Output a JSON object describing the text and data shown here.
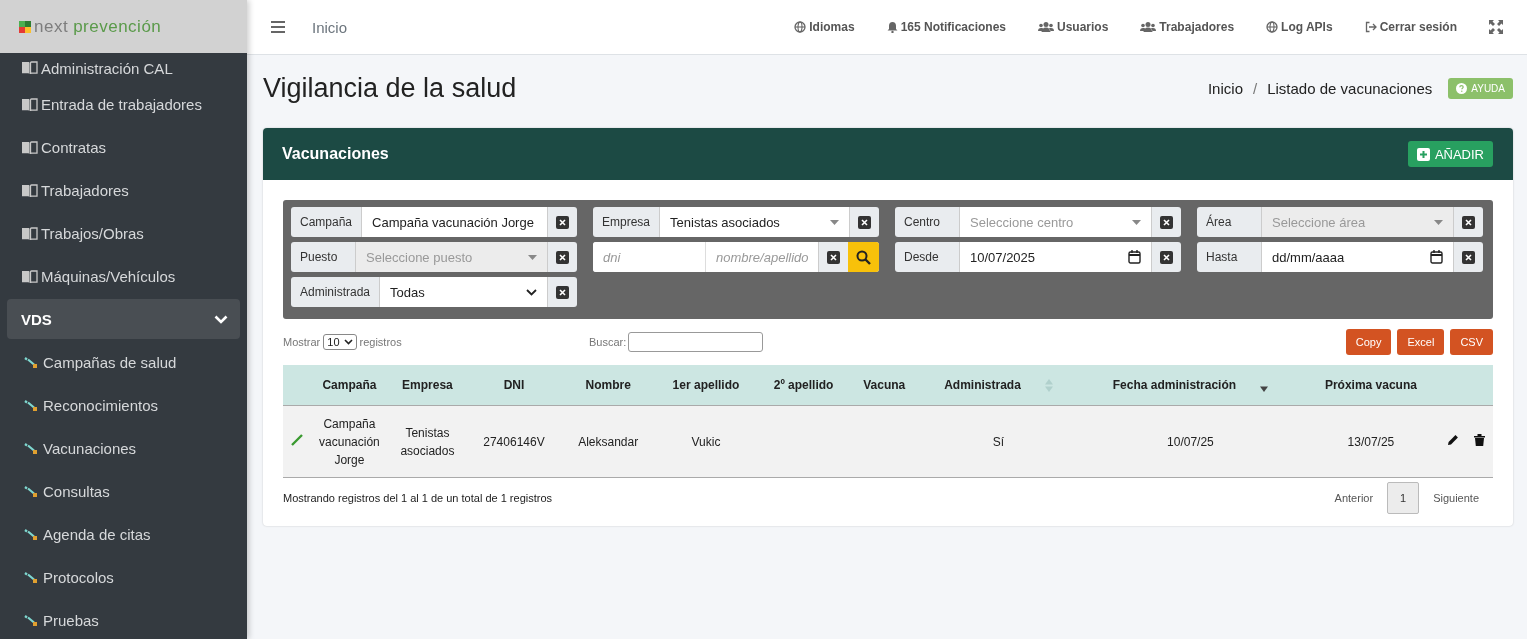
{
  "logo": {
    "part_1": "next",
    "part_2": "prevención"
  },
  "sidebar": {
    "items": [
      {
        "label": "Administración CAL",
        "kind": "book"
      },
      {
        "label": "Entrada de trabajadores",
        "kind": "book"
      },
      {
        "label": "Contratas",
        "kind": "book"
      },
      {
        "label": "Trabajadores",
        "kind": "book"
      },
      {
        "label": "Trabajos/Obras",
        "kind": "book"
      },
      {
        "label": "Máquinas/Vehículos",
        "kind": "book"
      },
      {
        "label": "VDS",
        "kind": "group",
        "expanded": true,
        "children": [
          {
            "label": "Campañas de salud"
          },
          {
            "label": "Reconocimientos"
          },
          {
            "label": "Vacunaciones"
          },
          {
            "label": "Consultas"
          },
          {
            "label": "Agenda de citas"
          },
          {
            "label": "Protocolos"
          },
          {
            "label": "Pruebas"
          }
        ]
      }
    ]
  },
  "topbar": {
    "breadcrumb": "Inicio",
    "links": [
      {
        "label": "Idiomas",
        "kind": "globe"
      },
      {
        "label": "165 Notificaciones",
        "kind": "bell"
      },
      {
        "label": "Usuarios",
        "kind": "users"
      },
      {
        "label": "Trabajadores",
        "kind": "users"
      },
      {
        "label": "Log APIs",
        "kind": "globe"
      },
      {
        "label": "Cerrar sesión",
        "kind": "logout"
      }
    ]
  },
  "page": {
    "title": "Vigilancia de la salud",
    "breadcrumb": [
      "Inicio",
      "Listado de vacunaciones"
    ],
    "breadcrumb_separator": "/",
    "help_button": "AYUDA"
  },
  "card": {
    "title": "Vacunaciones",
    "add_button": "AÑADIR",
    "filters": [
      {
        "kind": "select",
        "label": "Campaña",
        "value": "Campaña vacunación Jorge",
        "disabled": false
      },
      {
        "kind": "select",
        "label": "Empresa",
        "value": "Tenistas asociados",
        "disabled": false
      },
      {
        "kind": "select",
        "label": "Centro",
        "placeholder": "Seleccione centro",
        "disabled": false
      },
      {
        "kind": "select",
        "label": "Área",
        "placeholder": "Seleccione área",
        "disabled": true
      },
      {
        "kind": "select",
        "label": "Puesto",
        "placeholder": "Seleccione puesto",
        "disabled": true
      },
      {
        "kind": "search-pair",
        "placeholder": "dni",
        "placeholder_2": "nombre/apellido"
      },
      {
        "kind": "date",
        "label": "Desde",
        "value": "10/07/2025"
      },
      {
        "kind": "date",
        "label": "Hasta",
        "placeholder": "dd/mm/aaaa"
      },
      {
        "kind": "native-select",
        "label": "Administrada",
        "value": "Todas"
      }
    ],
    "length_label": "Mostrar",
    "length_value": "10",
    "length_suffix": "registros",
    "search_label": "Buscar:",
    "export_buttons": [
      "Copy",
      "Excel",
      "CSV"
    ],
    "columns": [
      {
        "label": "Campaña",
        "sortable": false
      },
      {
        "label": "Empresa",
        "sortable": false
      },
      {
        "label": "DNI",
        "sortable": false
      },
      {
        "label": "Nombre",
        "sortable": false
      },
      {
        "label": "1er apellido",
        "sortable": false
      },
      {
        "label": "2º apellido",
        "sortable": false
      },
      {
        "label": "Vacuna",
        "sortable": false
      },
      {
        "label": "Administrada",
        "sortable": true,
        "sorted_descending": false
      },
      {
        "label": "Fecha administración",
        "sortable": true,
        "sorted_descending": true
      },
      {
        "label": "Próxima vacuna",
        "sortable": false
      }
    ],
    "rows": [
      {
        "cells": [
          "Campaña vacunación Jorge",
          "Tenistas asociados",
          "27406146V",
          "Aleksandar",
          "Vukic",
          "",
          "",
          "Sí",
          "10/07/25",
          "13/07/25"
        ]
      }
    ],
    "info": "Mostrando registros del 1 al 1 de un total de 1 registros",
    "pagination": {
      "previous": "Anterior",
      "pages": [
        {
          "label": "1",
          "selected": true
        }
      ],
      "next": "Siguiente"
    }
  }
}
